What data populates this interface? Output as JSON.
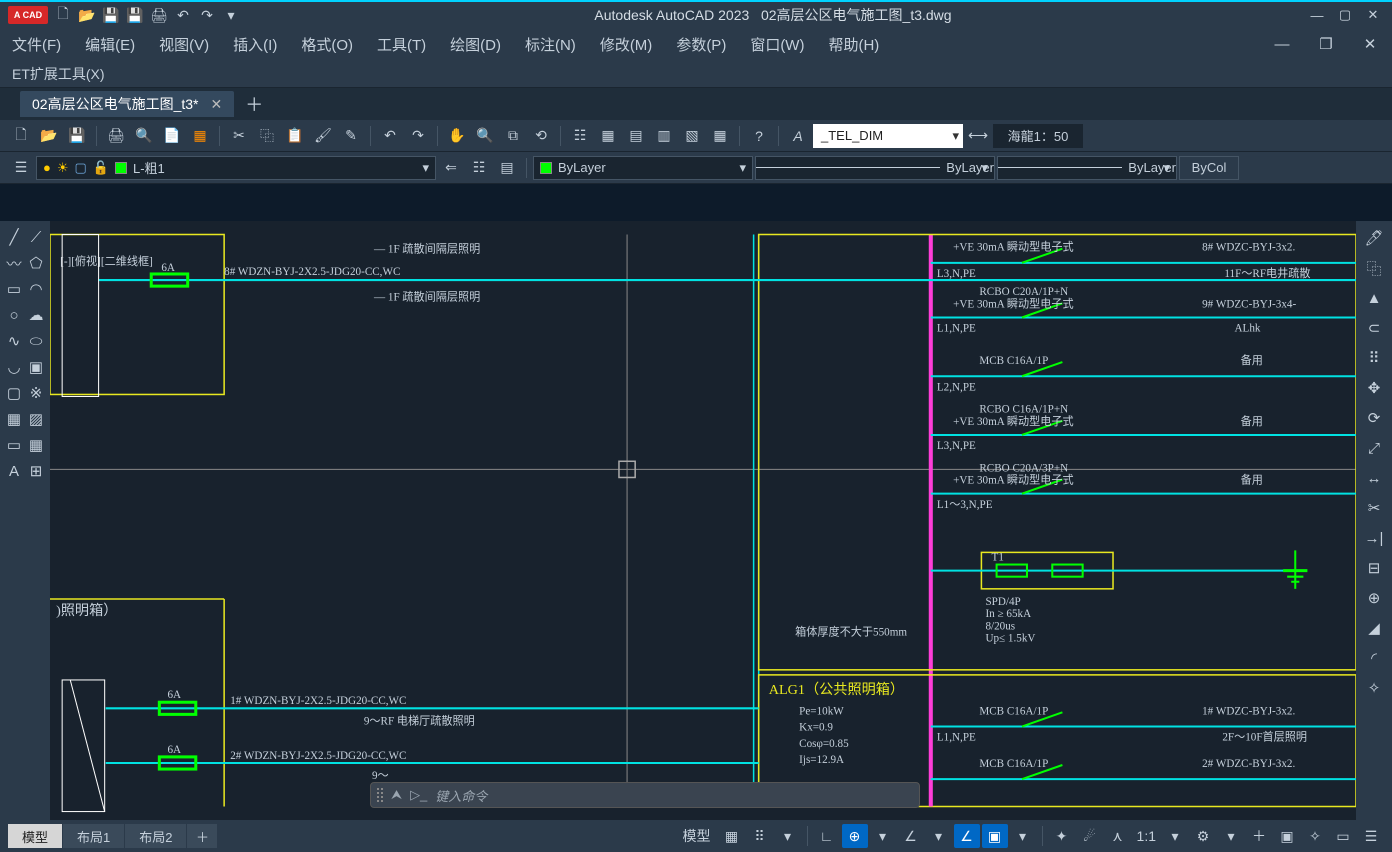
{
  "titlebar": {
    "app": "Autodesk AutoCAD 2023",
    "file": "02高层公区电气施工图_t3.dwg"
  },
  "menu": {
    "file": "文件(F)",
    "edit": "编辑(E)",
    "view": "视图(V)",
    "insert": "插入(I)",
    "format": "格式(O)",
    "tools": "工具(T)",
    "draw": "绘图(D)",
    "dim": "标注(N)",
    "modify": "修改(M)",
    "param": "参数(P)",
    "window": "窗口(W)",
    "help": "帮助(H)",
    "etext": "ET扩展工具(X)"
  },
  "tab": {
    "name": "02高层公区电气施工图_t3*"
  },
  "layers": {
    "current": "L-粗1"
  },
  "props": {
    "color": "ByLayer",
    "ltype": "ByLayer",
    "lweight": "ByLayer",
    "plot": "ByCol"
  },
  "dimstyle": "_TEL_DIM",
  "annoscale": "海龍1：50",
  "viewlabel": "[-][俯视][二维线框]",
  "cmd": {
    "placeholder": "键入命令"
  },
  "status": {
    "model": "模型",
    "layout1": "布局1",
    "layout2": "布局2",
    "scale": "1:1"
  },
  "circ": {
    "l1": "8# WDZN-BYJ-2X2.5-JDG20-CC,WC",
    "l1a": "— 1F 疏散间隔层照明",
    "l1b": "— 1F 疏散间隔层照明",
    "fuse1": "6A",
    "box": ")照明箱）",
    "b1": "1# WDZN-BYJ-2X2.5-JDG20-CC,WC",
    "b1a": "9～RF 电梯厅疏散照明",
    "b2": "2# WDZN-BYJ-2X2.5-JDG20-CC,WC",
    "b2a": "9～",
    "fuse2": "6A",
    "fuse3": "6A",
    "note": "箱体厚度不大于550mm",
    "r1a": "+VE 30mA 瞬动型电子式",
    "r1b": "L3,N,PE",
    "r1c": "8#  WDZC-BYJ-3x2.",
    "r1d": "11F～RF电井疏散",
    "r2a": "RCBO C20A/1P+N",
    "r2b": "+VE 30mA 瞬动型电子式",
    "r2c": "L1,N,PE",
    "r2d": "9#  WDZC-BYJ-3x4-",
    "r2e": "ALhk",
    "r3a": "MCB C16A/1P",
    "r3b": "L2,N,PE",
    "r3c": "备用",
    "r4a": "RCBO C16A/1P+N",
    "r4b": "+VE 30mA 瞬动型电子式",
    "r4c": "L3,N,PE",
    "r4d": "备用",
    "r5a": "RCBO C20A/3P+N",
    "r5b": "+VE 30mA 瞬动型电子式",
    "r5c": "L1～3,N,PE",
    "r5d": "备用",
    "spd1": "T1",
    "spd2": "SPD/4P",
    "spd3": "In ≥ 65kA",
    "spd4": "8/20us",
    "spd5": "Up≤ 1.5kV",
    "alg": "ALG1（公共照明箱）",
    "pe": "Pe=10kW",
    "kx": "Kx=0.9",
    "cos": "Cosφ=0.85",
    "ijs": "Ijs=12.9A",
    "a1a": "MCB C16A/1P",
    "a1b": "L1,N,PE",
    "a1c": "1#  WDZC-BYJ-3x2.",
    "a1d": "2F～10F首层照明",
    "a2a": "MCB C16A/1P",
    "a2c": "2#  WDZC-BYJ-3x2."
  }
}
